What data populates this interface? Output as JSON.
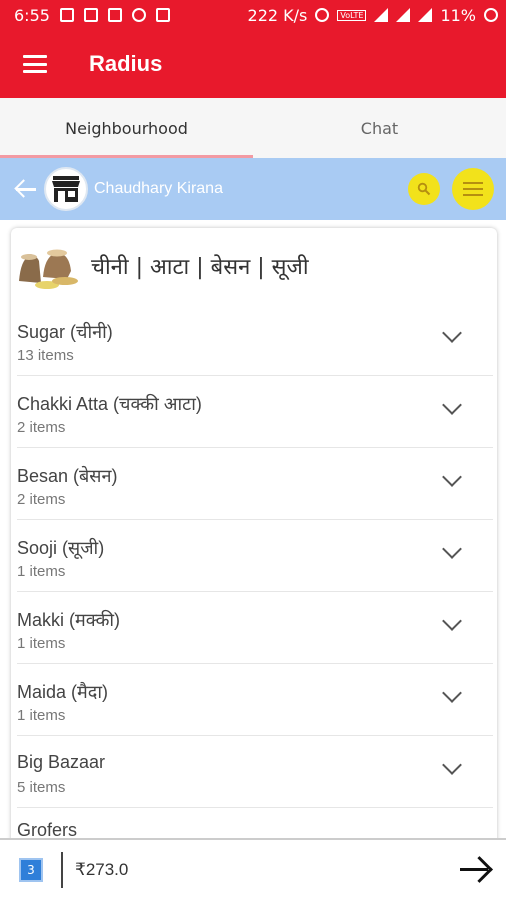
{
  "status_bar": {
    "time": "6:55",
    "network_speed": "222 K/s",
    "volte": "VoLTE",
    "battery": "11%"
  },
  "app": {
    "title": "Radius"
  },
  "tabs": [
    {
      "label": "Neighbourhood",
      "active": true
    },
    {
      "label": "Chat",
      "active": false
    }
  ],
  "shop": {
    "name": "Chaudhary Kirana"
  },
  "category": {
    "title": "चीनी | आटा | बेसन | सूजी"
  },
  "items": [
    {
      "title": "Sugar (चीनी)",
      "subtitle": "13 items"
    },
    {
      "title": "Chakki Atta (चक्की आटा)",
      "subtitle": "2 items"
    },
    {
      "title": "Besan (बेसन)",
      "subtitle": "2 items"
    },
    {
      "title": "Sooji (सूजी)",
      "subtitle": "1 items"
    },
    {
      "title": "Makki (मक्की)",
      "subtitle": "1 items"
    },
    {
      "title": "Maida (मैदा)",
      "subtitle": "1 items"
    },
    {
      "title": "Big Bazaar",
      "subtitle": "5 items"
    },
    {
      "title": "Grofers",
      "subtitle": ""
    }
  ],
  "cart": {
    "count": "3",
    "total": "₹273.0"
  },
  "colors": {
    "primary": "#e8192c",
    "shop_bar": "#a9cbf3",
    "accent_yellow": "#f2e21b",
    "badge_blue": "#2f7fd9"
  }
}
